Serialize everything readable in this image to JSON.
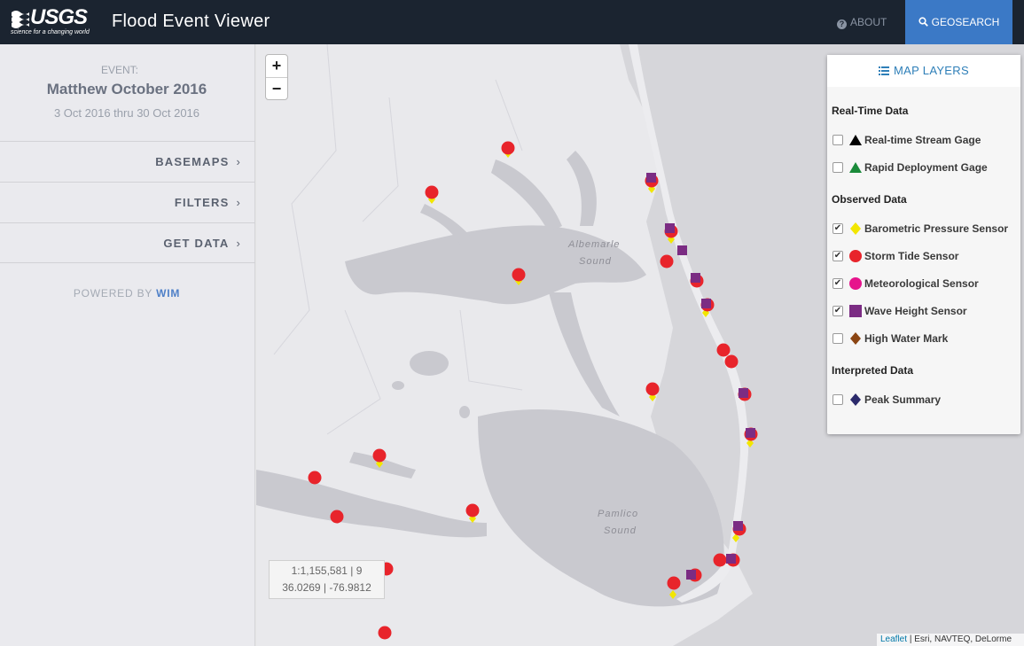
{
  "header": {
    "logo_text": "USGS",
    "logo_tagline": "science for a changing world",
    "app_title": "Flood Event Viewer",
    "about_label": "ABOUT",
    "geosearch_label": "GEOSEARCH"
  },
  "sidebar": {
    "event_label": "EVENT:",
    "event_name": "Matthew October 2016",
    "event_dates": "3 Oct 2016 thru 30 Oct 2016",
    "items": [
      {
        "label": "BASEMAPS"
      },
      {
        "label": "FILTERS"
      },
      {
        "label": "GET DATA"
      }
    ],
    "powered_by": "POWERED BY",
    "powered_by_brand": "WIM"
  },
  "map": {
    "zoom_in": "+",
    "zoom_out": "−",
    "scale_line": "1:1,155,581 | 9",
    "coords_line": "36.0269 | -76.9812",
    "labels": {
      "albemarle_1": "Albemarle",
      "albemarle_2": "Sound",
      "pamlico_1": "Pamlico",
      "pamlico_2": "Sound"
    },
    "attribution_link": "Leaflet",
    "attribution_rest": "| Esri, NAVTEQ, DeLorme"
  },
  "layers": {
    "title": "MAP LAYERS",
    "groups": [
      {
        "title": "Real-Time Data",
        "items": [
          {
            "label": "Real-time Stream Gage",
            "checked": false,
            "symbol": "triangle",
            "color": "#000000"
          },
          {
            "label": "Rapid Deployment Gage",
            "checked": false,
            "symbol": "triangle",
            "color": "#1a8a3a"
          }
        ]
      },
      {
        "title": "Observed Data",
        "items": [
          {
            "label": "Barometric Pressure Sensor",
            "checked": true,
            "symbol": "diamond",
            "color": "#f2e600"
          },
          {
            "label": "Storm Tide Sensor",
            "checked": true,
            "symbol": "circle",
            "color": "#e8242b"
          },
          {
            "label": "Meteorological Sensor",
            "checked": true,
            "symbol": "circle",
            "color": "#e6148c"
          },
          {
            "label": "Wave Height Sensor",
            "checked": true,
            "symbol": "square",
            "color": "#7b2c83"
          },
          {
            "label": "High Water Mark",
            "checked": false,
            "symbol": "diamond",
            "color": "#8b4513"
          }
        ]
      },
      {
        "title": "Interpreted Data",
        "items": [
          {
            "label": "Peak Summary",
            "checked": false,
            "symbol": "diamond",
            "color": "#2b2a6b"
          }
        ]
      }
    ]
  },
  "colors": {
    "navbar": "#1b2430",
    "geosearch": "#3b79c6",
    "storm_tide": "#e8242b",
    "wave_height": "#7b2c83",
    "barometric": "#f2e600",
    "water": "#c8c8cd",
    "land": "#e9e9ec"
  }
}
